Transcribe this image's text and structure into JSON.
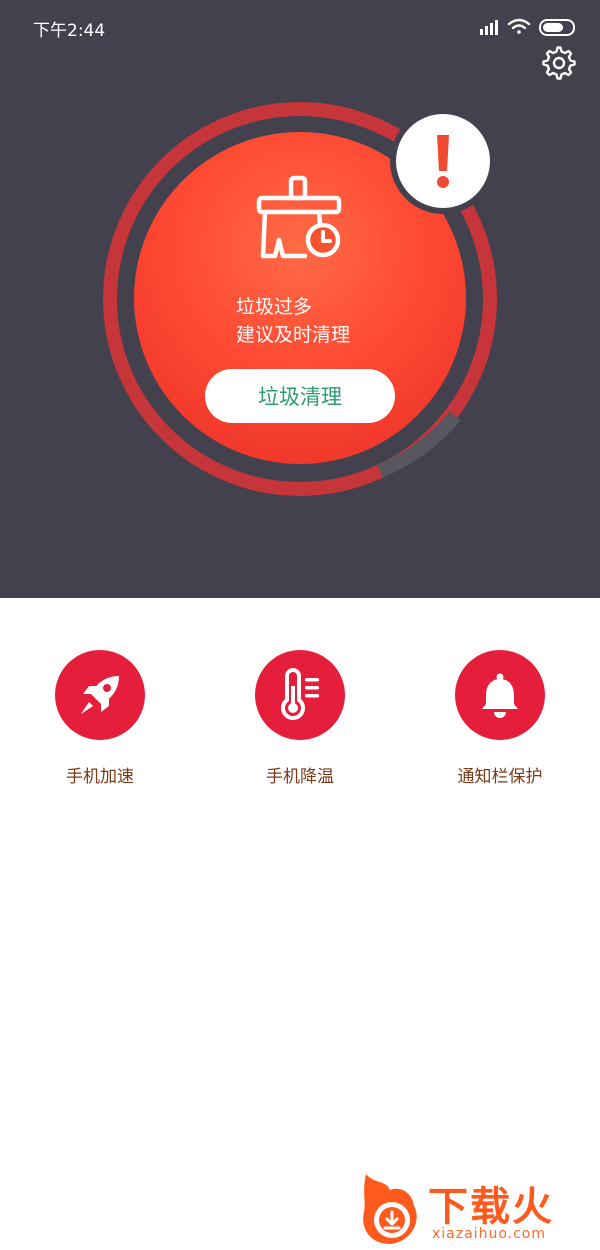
{
  "status_bar": {
    "time": "下午2:44"
  },
  "cleaner": {
    "headline": "垃圾过多",
    "subline": "建议及时清理",
    "clean_button_label": "垃圾清理",
    "alert_symbol": "!"
  },
  "tools": [
    {
      "label": "手机加速",
      "icon": "rocket-icon"
    },
    {
      "label": "手机降温",
      "icon": "thermometer-icon"
    },
    {
      "label": "通知栏保护",
      "icon": "bell-icon"
    }
  ],
  "watermark": {
    "title": "下载火",
    "subtitle": "xiazaihuo.com"
  },
  "colors": {
    "header_bg": "#42414d",
    "core_red": "#f23a2c",
    "ring_red": "#c5353a",
    "tool_red": "#e51e3c",
    "clean_text": "#2e9c6e"
  }
}
